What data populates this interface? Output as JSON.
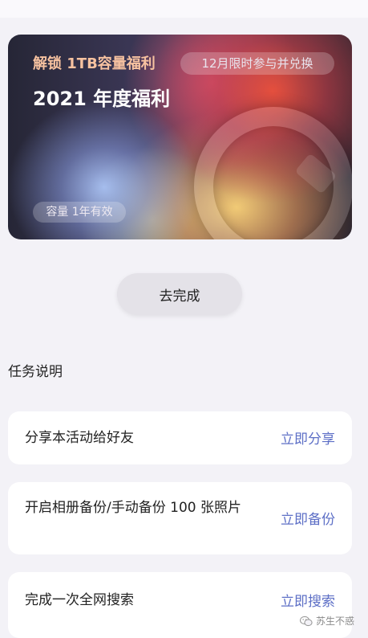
{
  "banner": {
    "title": "解锁 1TB容量福利",
    "pill": "12月限时参与并兑换",
    "heading": "2021 年度福利",
    "badge": "容量 1年有效"
  },
  "complete_button": "去完成",
  "section_label": "任务说明",
  "tasks": [
    {
      "text": "分享本活动给好友",
      "action": "立即分享"
    },
    {
      "text": "开启相册备份/手动备份 100 张照片",
      "action": "立即备份"
    },
    {
      "text": "完成一次全网搜索",
      "action": "立即搜索"
    }
  ],
  "watermark": {
    "icon": "wechat-icon",
    "text": "苏生不惑"
  }
}
